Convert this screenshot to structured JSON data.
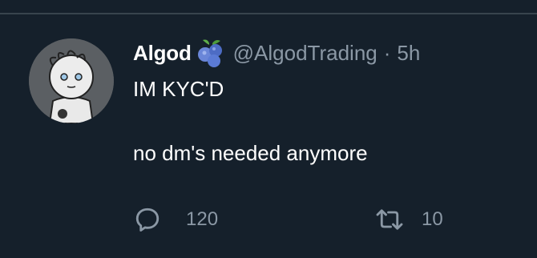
{
  "tweet": {
    "author": {
      "display_name": "Algod",
      "badge_icon": "blueberry-icon",
      "handle": "@AlgodTrading",
      "separator": "·",
      "time": "5h"
    },
    "text_lines": [
      "IM KYC'D",
      "no dm's needed anymore"
    ]
  },
  "actions": {
    "reply": {
      "icon": "reply-icon",
      "count": "120"
    },
    "retweet": {
      "icon": "retweet-icon",
      "count": "10"
    }
  },
  "colors": {
    "background": "#15202b",
    "text_primary": "#ffffff",
    "text_secondary": "#8b98a5",
    "divider": "#38444d",
    "badge_blue": "#5b7bd5",
    "badge_leaf": "#5fae4a"
  }
}
